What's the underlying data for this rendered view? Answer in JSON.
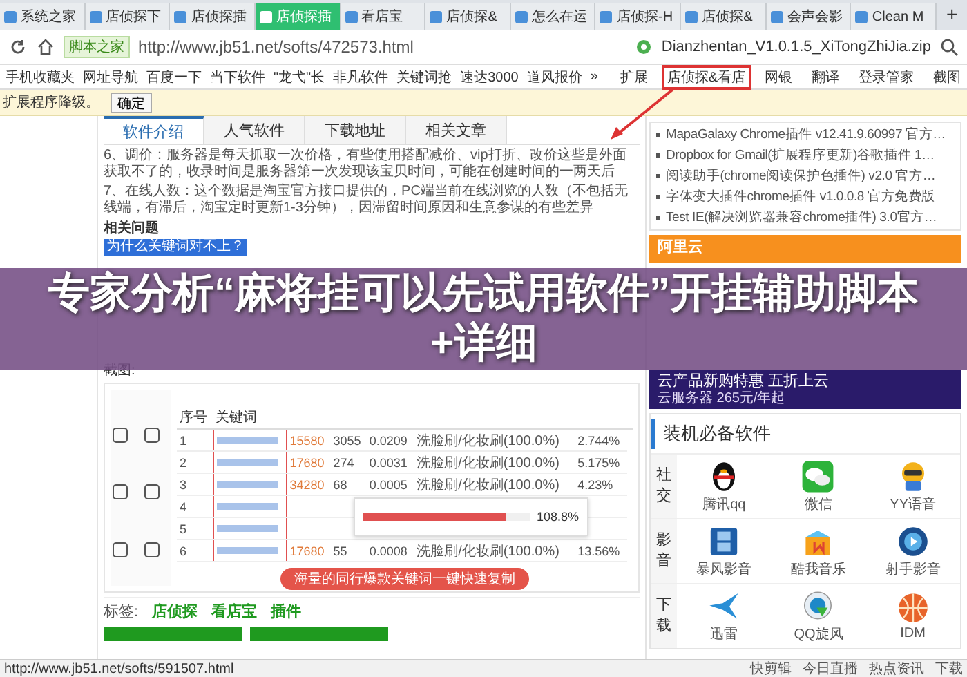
{
  "browser_tabs": [
    {
      "label": "系统之家",
      "selected": false
    },
    {
      "label": "店侦探下",
      "selected": false
    },
    {
      "label": "店侦探插",
      "selected": false
    },
    {
      "label": "店侦探插",
      "selected": true
    },
    {
      "label": "看店宝",
      "selected": false
    },
    {
      "label": "店侦探&",
      "selected": false
    },
    {
      "label": "怎么在运",
      "selected": false
    },
    {
      "label": "店侦探-H",
      "selected": false
    },
    {
      "label": "店侦探&",
      "selected": false
    },
    {
      "label": "会声会影",
      "selected": false
    },
    {
      "label": "Clean M",
      "selected": false
    }
  ],
  "new_tab": "+",
  "address_bar": {
    "badge": "脚本之家",
    "url": "http://www.jb51.net/softs/472573.html",
    "download_file": "Dianzhentan_V1.0.1.5_XiTongZhiJia.zip"
  },
  "bookmarks": [
    "手机收藏夹",
    "网址导航",
    "百度一下",
    "当下软件",
    "\"龙弋\"长",
    "非凡软件",
    "关键词抢",
    "速达3000",
    "道风报价"
  ],
  "bookmarks_more": "»",
  "extensions": [
    {
      "label": "扩展",
      "highlighted": false
    },
    {
      "label": "店侦探&看店",
      "highlighted": true
    },
    {
      "label": "网银",
      "highlighted": false
    },
    {
      "label": "翻译",
      "highlighted": false
    },
    {
      "label": "登录管家",
      "highlighted": false
    },
    {
      "label": "截图",
      "highlighted": false
    }
  ],
  "info_bar": {
    "message": "扩展程序降级。",
    "button": "确定"
  },
  "page_tabs": [
    {
      "label": "软件介绍",
      "selected": true
    },
    {
      "label": "人气软件",
      "selected": false
    },
    {
      "label": "下载地址",
      "selected": false
    },
    {
      "label": "相关文章",
      "selected": false
    }
  ],
  "paragraphs": [
    "6、调价：服务器是每天抓取一次价格，有些使用搭配减价、vip打折、改价这些是外面获取不了的，收录时间是服务器第一次发现该宝贝时间，可能在创建时间的一两天后",
    "7、在线人数：这个数据是淘宝官方接口提供的，PC端当前在线浏览的人数（不包括无线端，有滞后，淘宝定时更新1-3分钟），因滞留时间原因和生意参谋的有些差异"
  ],
  "related": {
    "heading": "相关问题",
    "question": "为什么关键词对不上？"
  },
  "screenshot_label": "截图:",
  "screenshot": {
    "columns": [
      "序号",
      "关键词"
    ],
    "rows": [
      {
        "no": "1",
        "popularity": "15580",
        "clicks": "3055",
        "ctr": "0.0209",
        "category": "洗脸刷/化妆刷(100.0%)",
        "conversion": "2.744%"
      },
      {
        "no": "2",
        "popularity": "17680",
        "clicks": "274",
        "ctr": "0.0031",
        "category": "洗脸刷/化妆刷(100.0%)",
        "conversion": "5.175%"
      },
      {
        "no": "3",
        "popularity": "34280",
        "clicks": "68",
        "ctr": "0.0005",
        "category": "洗脸刷/化妆刷(100.0%)",
        "conversion": "4.23%"
      },
      {
        "no": "4"
      },
      {
        "no": "5"
      },
      {
        "no": "6",
        "popularity": "17680",
        "clicks": "55",
        "ctr": "0.0008",
        "category": "洗脸刷/化妆刷(100.0%)",
        "conversion": "13.56%"
      }
    ],
    "popup": {
      "value": "108.8%",
      "level": 0.85
    },
    "button": "海量的同行爆款关键词一键快速复制"
  },
  "tags": {
    "label": "标签:",
    "items": [
      "店侦探",
      "看店宝",
      "插件"
    ]
  },
  "sidebar_links": [
    "MapaGalaxy Chrome插件 v12.41.9.60997 官方…",
    "Dropbox for Gmail(扩展程序更新)谷歌插件 1…",
    "阅读助手(chrome阅读保护色插件) v2.0 官方…",
    "字体变大插件chrome插件 v1.0.0.8 官方免费版",
    "Test IE(解决浏览器兼容chrome插件) 3.0官方…"
  ],
  "ads": [
    {
      "kind": "aliyun",
      "brand": "阿里云"
    },
    {
      "kind": "tencent",
      "headline": "云产品新购特惠 五折上云",
      "sub": "云服务器 265元/年起"
    }
  ],
  "essentials": {
    "title": "装机必备软件",
    "groups": [
      {
        "category": "社交",
        "apps": [
          {
            "name": "腾讯qq",
            "kind": "penguin"
          },
          {
            "name": "微信",
            "kind": "chat"
          },
          {
            "name": "YY语音",
            "kind": "mascot"
          }
        ]
      },
      {
        "category": "影音",
        "apps": [
          {
            "name": "暴风影音",
            "kind": "film"
          },
          {
            "name": "酷我音乐",
            "kind": "box"
          },
          {
            "name": "射手影音",
            "kind": "disc"
          }
        ]
      },
      {
        "category": "下载",
        "apps": [
          {
            "name": "迅雷",
            "kind": "bird"
          },
          {
            "name": "QQ旋风",
            "kind": "swirl"
          },
          {
            "name": "IDM",
            "kind": "globe"
          }
        ]
      }
    ]
  },
  "status_bar": {
    "url": "http://www.jb51.net/softs/591507.html",
    "clip_tool": "快剪辑",
    "tools": [
      "今日直播",
      "热点资讯",
      "下载"
    ]
  },
  "banner": {
    "title": "专家分析“麻将挂可以先试用软件”开挂辅助脚本+详细"
  }
}
